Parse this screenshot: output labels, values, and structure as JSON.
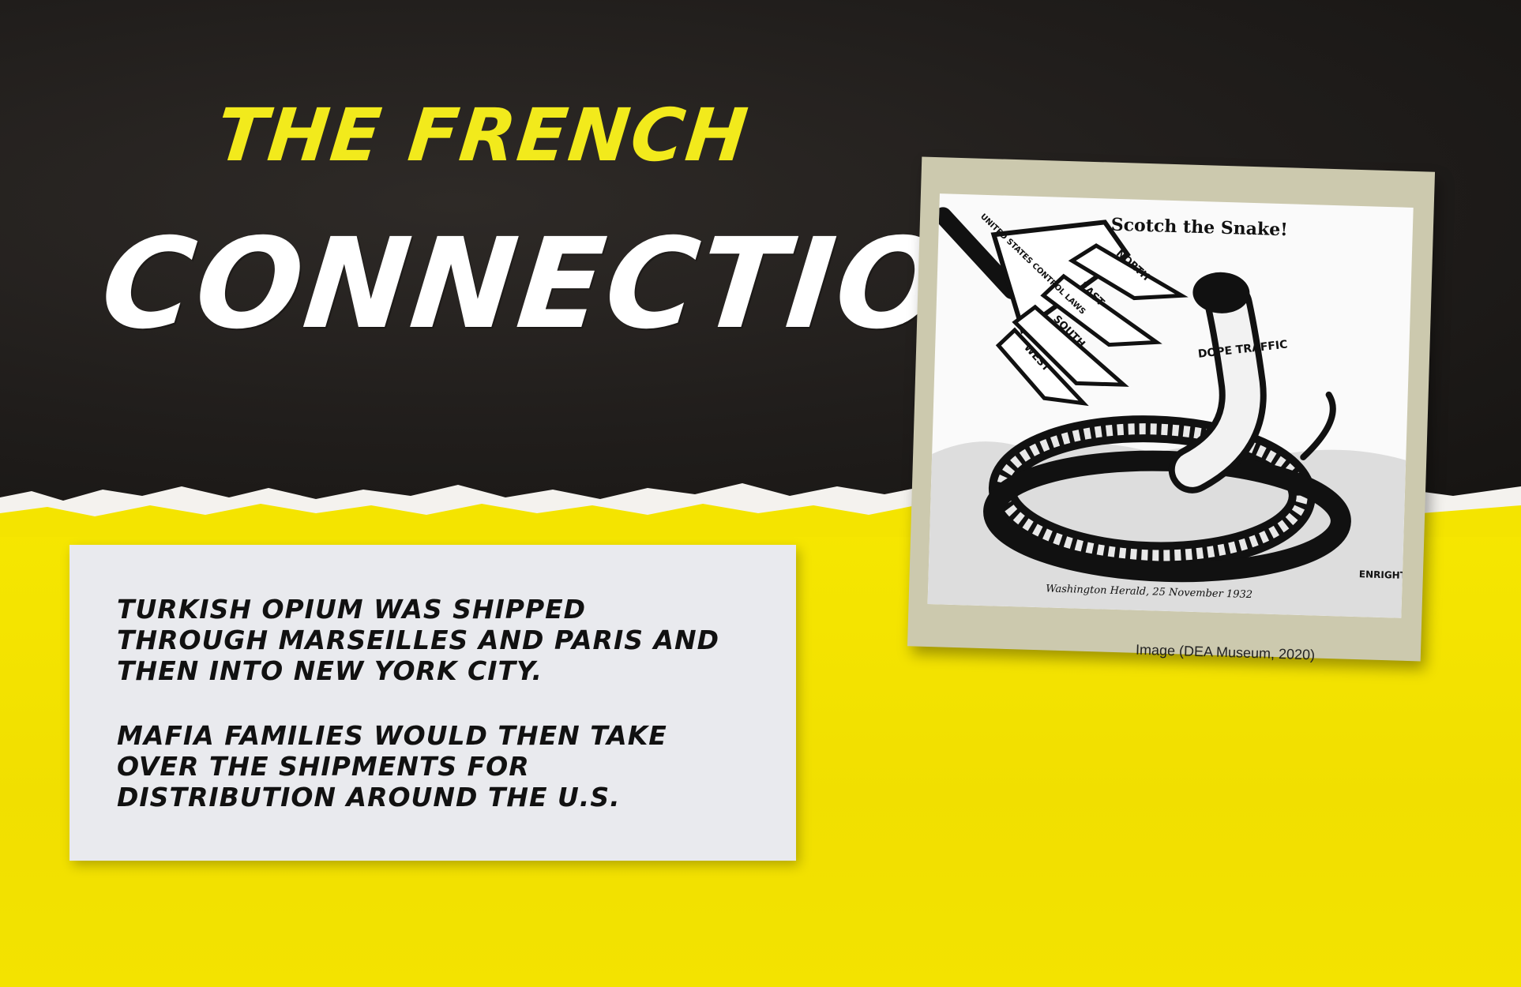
{
  "title": {
    "line1": "The French",
    "line2": "Connection"
  },
  "note": {
    "paragraph1": "Turkish opium was shipped through Marseilles and Paris and then into New York City.",
    "paragraph2": "Mafia families would then take over the shipments for distribution around the U.S."
  },
  "cartoon": {
    "headline": "Scotch the Snake!",
    "fork_handle_label": "UNITED STATES CONTROL LAWS",
    "prong_labels": [
      "NORTH",
      "EAST",
      "SOUTH",
      "WEST"
    ],
    "snake_label": "DOPE TRAFFIC",
    "signature": "ENRIGHT",
    "source_line": "Washington Herald, 25 November 1932"
  },
  "caption": "Image (DEA Museum, 2020)",
  "colors": {
    "background_dark": "#201d1b",
    "background_yellow": "#f4e400",
    "title_yellow": "#f2ea1c",
    "title_white": "#ffffff",
    "card": "#e9eaee",
    "frame": "#ccc9ae"
  }
}
